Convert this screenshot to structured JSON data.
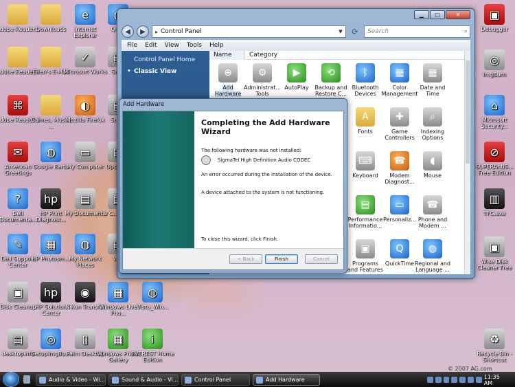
{
  "desktop": {
    "icons": [
      {
        "label": "Adobe Reader...",
        "icon": "folder-icon"
      },
      {
        "label": "Downloads",
        "icon": "folder-icon"
      },
      {
        "label": "Internet Explorer",
        "icon": "ie-icon"
      },
      {
        "label": "Qui...",
        "icon": "app-icon"
      },
      {
        "label": "Adobe Reader...",
        "icon": "folder-icon"
      },
      {
        "label": "Ellen's E-Mail",
        "icon": "folder-icon"
      },
      {
        "label": "Microsoft Works",
        "icon": "works-icon"
      },
      {
        "label": "Sm...",
        "icon": "app-icon"
      },
      {
        "label": "Adobe Reader 9",
        "icon": "pdf-icon"
      },
      {
        "label": "Games, Music, ...",
        "icon": "folder-icon"
      },
      {
        "label": "Mozilla Firefox",
        "icon": "firefox-icon"
      },
      {
        "label": "Sna...",
        "icon": "app-icon"
      },
      {
        "label": "American Greetings",
        "icon": "card-icon"
      },
      {
        "label": "Google Earth",
        "icon": "globe-icon"
      },
      {
        "label": "My Computer",
        "icon": "computer-icon"
      },
      {
        "label": "Upcom...",
        "icon": "app-icon"
      },
      {
        "label": "Dell Documenta...",
        "icon": "help-icon"
      },
      {
        "label": "HP Print Diagnost...",
        "icon": "hp-icon"
      },
      {
        "label": "My Documents",
        "icon": "documents-icon"
      },
      {
        "label": "v C... ph...",
        "icon": "app-icon"
      },
      {
        "label": "Dell Support Center",
        "icon": "tools-icon"
      },
      {
        "label": "HP Photosm...",
        "icon": "photo-icon"
      },
      {
        "label": "My Network Places",
        "icon": "network-icon"
      },
      {
        "label": "W...",
        "icon": "app-icon"
      },
      {
        "label": "Disk Cleanup",
        "icon": "disk-icon"
      },
      {
        "label": "HP Solution Center",
        "icon": "hp-icon"
      },
      {
        "label": "Nikon Transfer",
        "icon": "camera-icon"
      },
      {
        "label": "Windows Live Pho...",
        "icon": "photo-icon"
      },
      {
        "label": "Vista_Win...",
        "icon": "app-icon"
      },
      {
        "label": "desktopinfo",
        "icon": "app-icon"
      },
      {
        "label": "SetupImgBu...",
        "icon": "disc-icon"
      },
      {
        "label": "Palm Desktop",
        "icon": "palm-icon"
      },
      {
        "label": "Windows Photo Gallery",
        "icon": "photo-icon"
      },
      {
        "label": "EVEREST Home Edition",
        "icon": "info-icon"
      },
      {
        "label": "Debugger",
        "icon": "app-icon"
      },
      {
        "label": "ImgBurn",
        "icon": "disc-icon"
      },
      {
        "label": "Microsoft Security...",
        "icon": "security-icon"
      },
      {
        "label": "SUPERAntiS... Free Edition",
        "icon": "shield-icon"
      },
      {
        "label": "TFC.exe",
        "icon": "trash-icon"
      },
      {
        "label": "Wise Disk Cleaner Free",
        "icon": "disk-icon"
      },
      {
        "label": "Recycle Bin - Shortcut",
        "icon": "recycle-icon"
      }
    ],
    "copyright": "© 2007 AG.com"
  },
  "control_panel": {
    "address": "Control Panel",
    "search_placeholder": "Search",
    "menu": [
      "File",
      "Edit",
      "View",
      "Tools",
      "Help"
    ],
    "sidebar": {
      "home": "Control Panel Home",
      "classic": "Classic View"
    },
    "columns": [
      "Name",
      "Category"
    ],
    "items": [
      {
        "label": "Add Hardware",
        "icon": "add-hardware-icon",
        "selected": true
      },
      {
        "label": "Administrat... Tools",
        "icon": "admin-tools-icon"
      },
      {
        "label": "AutoPlay",
        "icon": "autoplay-icon"
      },
      {
        "label": "Backup and Restore C...",
        "icon": "backup-icon"
      },
      {
        "label": "Bluetooth Devices",
        "icon": "bluetooth-icon"
      },
      {
        "label": "Color Management",
        "icon": "color-management-icon"
      },
      {
        "label": "Date and Time",
        "icon": "calendar-icon"
      },
      {
        "label": "Fonts",
        "icon": "fonts-icon"
      },
      {
        "label": "Game Controllers",
        "icon": "gamepad-icon"
      },
      {
        "label": "Indexing Options",
        "icon": "indexing-icon"
      },
      {
        "label": "Keyboard",
        "icon": "keyboard-icon"
      },
      {
        "label": "Modem Diagnost...",
        "icon": "modem-icon"
      },
      {
        "label": "Mouse",
        "icon": "mouse-icon"
      },
      {
        "label": "Performance Informatio...",
        "icon": "performance-icon"
      },
      {
        "label": "Personaliz...",
        "icon": "personalize-icon"
      },
      {
        "label": "Phone and Modem ...",
        "icon": "phone-icon"
      },
      {
        "label": "Programs and Features",
        "icon": "programs-icon"
      },
      {
        "label": "QuickTime",
        "icon": "quicktime-icon"
      },
      {
        "label": "Regional and Language ...",
        "icon": "globe-icon"
      }
    ]
  },
  "dialog": {
    "title": "Add Hardware",
    "heading": "Completing the Add Hardware Wizard",
    "not_installed": "The following hardware was not installed:",
    "hardware_name": "SigmaTel High Definition Audio CODEC",
    "error": "An error occurred during the installation of the device.",
    "not_functioning": "A device attached to the system is not functioning.",
    "finish_note": "To close this wizard, click Finish.",
    "buttons": {
      "back": "< Back",
      "finish": "Finish",
      "cancel": "Cancel"
    }
  },
  "taskbar": {
    "buttons": [
      {
        "label": "Audio & Video - Wi..."
      },
      {
        "label": "Sound & Audio - Vi..."
      },
      {
        "label": "Control Panel"
      },
      {
        "label": "Add Hardware",
        "active": true
      }
    ],
    "clock": "11:35 AM"
  },
  "colors": {
    "desktop": "#d2b3c8",
    "sidebar": "#2a5a8e",
    "dialog_side": "#1b7a72",
    "taskbar": "#1a1a1a"
  }
}
